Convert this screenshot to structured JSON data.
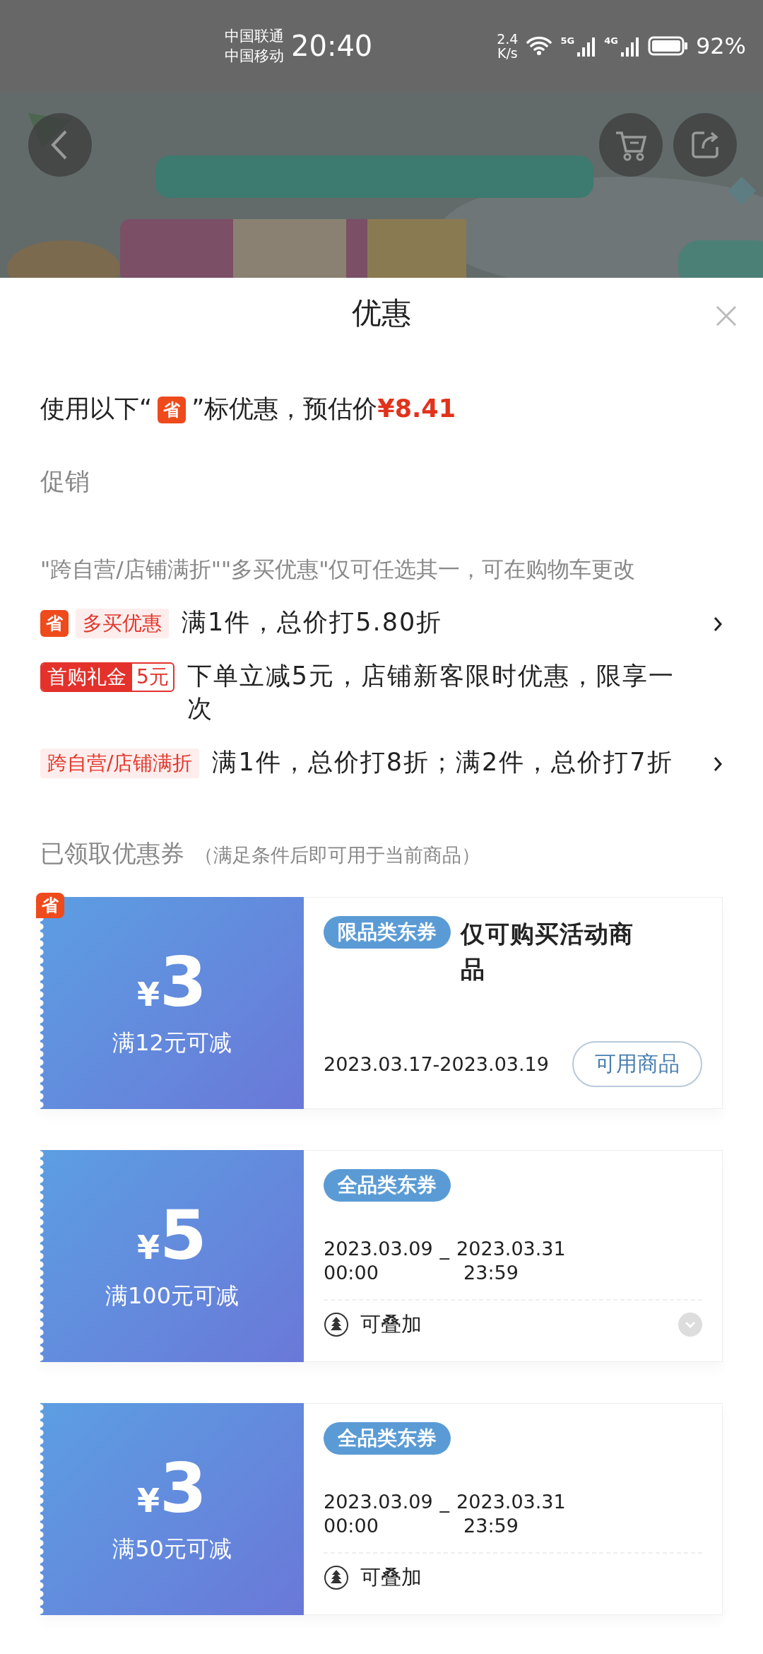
{
  "status_bar": {
    "carriers": [
      "中国联通",
      "中国移动"
    ],
    "time": "20:40",
    "speed": "2.4",
    "speed_unit": "K/s",
    "networks": [
      "5G",
      "4G"
    ],
    "battery": "92%"
  },
  "sheet": {
    "title": "优惠",
    "estimate": {
      "prefix": "使用以下“",
      "badge": "省",
      "suffix": "”标优惠，预估价",
      "price": "¥8.41"
    },
    "promotions_heading": "促销",
    "promotions_note": "\"跨自营/店铺满折\"\"多买优惠\"仅可任选其一，可在购物车更改",
    "promotions": [
      {
        "kind": "tag",
        "save_badge": "省",
        "tag": "多买优惠",
        "text": "满1件，总价打5.80折",
        "has_arrow": true
      },
      {
        "kind": "gift",
        "tag": "首购礼金",
        "amount": "5元",
        "text": "下单立减5元，店铺新客限时优惠，限享一次",
        "has_arrow": false
      },
      {
        "kind": "tag",
        "tag": "跨自营/店铺满折",
        "text": "满1件，总价打8折；满2件，总价打7折",
        "has_arrow": true
      }
    ],
    "coupons_heading": "已领取优惠券",
    "coupons_note": "（满足条件后即可用于当前商品）",
    "coupons": [
      {
        "kind": "limited",
        "save_badge": "省",
        "currency": "¥",
        "amount": "3",
        "condition": "满12元可减",
        "category": "限品类东券",
        "title": "仅可购买活动商品",
        "validity": "2023.03.17-2023.03.19",
        "button": "可用商品"
      },
      {
        "kind": "stackable",
        "currency": "¥",
        "amount": "5",
        "condition": "满100元可减",
        "category": "全品类东券",
        "start_date": "2023.03.09",
        "separator": "_",
        "end_date": "2023.03.31",
        "start_time": "00:00",
        "end_time": "23:59",
        "stack_label": "可叠加",
        "expandable": true
      },
      {
        "kind": "stackable",
        "currency": "¥",
        "amount": "3",
        "condition": "满50元可减",
        "category": "全品类东券",
        "start_date": "2023.03.09",
        "separator": "_",
        "end_date": "2023.03.31",
        "start_time": "00:00",
        "end_time": "23:59",
        "stack_label": "可叠加",
        "expandable": false
      }
    ]
  }
}
